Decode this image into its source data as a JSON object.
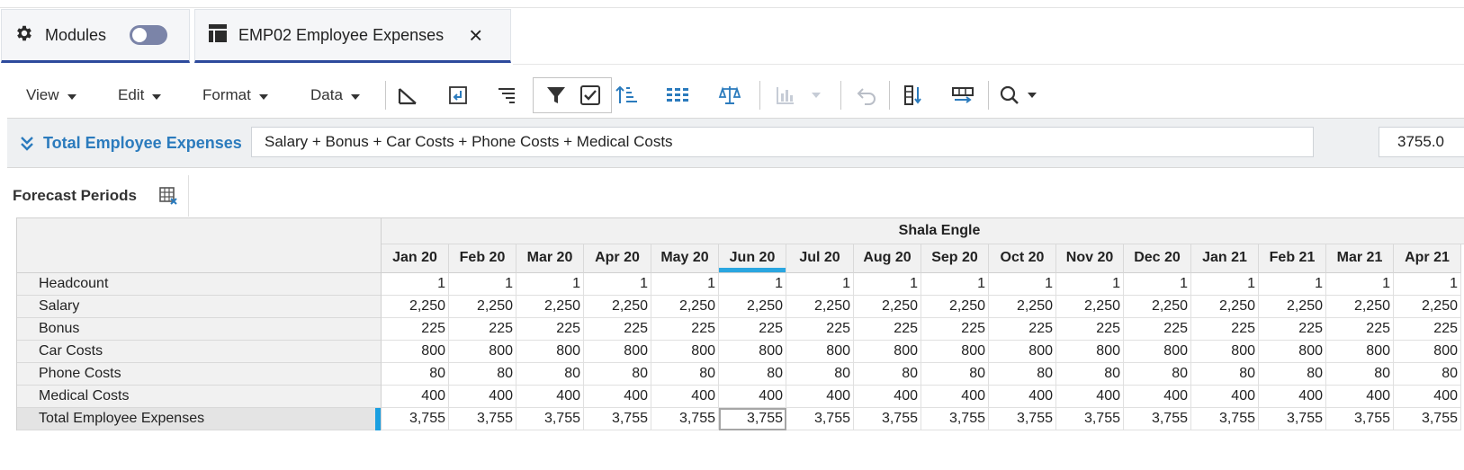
{
  "tabs": [
    {
      "label": "Modules",
      "icon": "gear-icon"
    },
    {
      "label": "EMP02 Employee Expenses",
      "icon": "table-icon"
    }
  ],
  "toolbar": {
    "menus": [
      "View",
      "Edit",
      "Format",
      "Data"
    ]
  },
  "formula_bar": {
    "label": "Total Employee Expenses",
    "formula": "Salary + Bonus + Car Costs + Phone Costs + Medical Costs",
    "value": "3755.0"
  },
  "forecast": {
    "label": "Forecast Periods"
  },
  "grid": {
    "group_header": "Shala Engle",
    "columns": [
      "Jan 20",
      "Feb 20",
      "Mar 20",
      "Apr 20",
      "May 20",
      "Jun 20",
      "Jul 20",
      "Aug 20",
      "Sep 20",
      "Oct 20",
      "Nov 20",
      "Dec 20",
      "Jan 21",
      "Feb 21",
      "Mar 21",
      "Apr 21"
    ],
    "selected_column_index": 5,
    "rows": [
      {
        "label": "Headcount",
        "value": "1"
      },
      {
        "label": "Salary",
        "value": "2,250"
      },
      {
        "label": "Bonus",
        "value": "225"
      },
      {
        "label": "Car Costs",
        "value": "800"
      },
      {
        "label": "Phone Costs",
        "value": "80"
      },
      {
        "label": "Medical Costs",
        "value": "400"
      },
      {
        "label": "Total Employee Expenses",
        "value": "3,755"
      }
    ]
  },
  "colors": {
    "accent_blue": "#2b7bbd",
    "tab_underline": "#2d4a9c",
    "selection_blue": "#2aa6e0"
  }
}
